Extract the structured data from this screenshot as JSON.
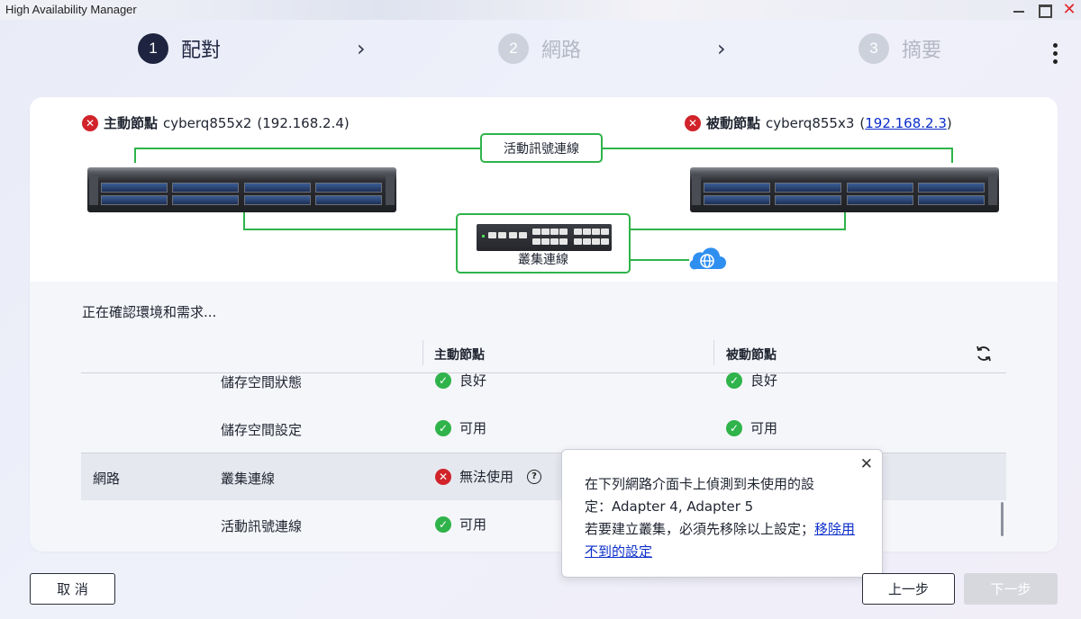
{
  "window": {
    "title": "High Availability Manager"
  },
  "stepper": {
    "steps": [
      {
        "num": "1",
        "label": "配對",
        "state": "active"
      },
      {
        "num": "2",
        "label": "網路",
        "state": "inactive"
      },
      {
        "num": "3",
        "label": "摘要",
        "state": "inactive"
      }
    ],
    "separator": "›"
  },
  "diagram": {
    "primary": {
      "role": "主動節點",
      "host": "cyberq855x2",
      "ip_prefix": "(",
      "ip": "192.168.2.4",
      "ip_suffix": ")"
    },
    "passive": {
      "role": "被動節點",
      "host": "cyberq855x3",
      "ip_prefix": "(",
      "ip": "192.168.2.3",
      "ip_suffix": ")"
    },
    "heartbeat_label": "活動訊號連線",
    "cluster_label": "叢集連線",
    "colors": {
      "link": "#2fb34a",
      "error": "#d1232a"
    }
  },
  "checks": {
    "status_text": "正在確認環境和需求...",
    "headers": {
      "primary": "主動節點",
      "passive": "被動節點"
    },
    "rows": [
      {
        "group": "",
        "item": "儲存空間狀態",
        "primary": "良好",
        "primary_status": "ok",
        "passive": "良好",
        "passive_status": "ok"
      },
      {
        "group": "",
        "item": "儲存空間設定",
        "primary": "可用",
        "primary_status": "ok",
        "passive": "可用",
        "passive_status": "ok"
      },
      {
        "group": "網路",
        "item": "叢集連線",
        "primary": "無法使用",
        "primary_status": "error",
        "passive": "",
        "passive_status": ""
      },
      {
        "group": "",
        "item": "活動訊號連線",
        "primary": "可用",
        "primary_status": "ok",
        "passive": "",
        "passive_status": ""
      }
    ]
  },
  "popover": {
    "line1": "在下列網路介面卡上偵測到未使用的設",
    "line2": "定：Adapter 4, Adapter 5",
    "line3": "若要建立叢集，必須先移除以上設定；",
    "link": "移除用不到的設定"
  },
  "footer": {
    "cancel": "取 消",
    "prev": "上一步",
    "next": "下一步"
  }
}
